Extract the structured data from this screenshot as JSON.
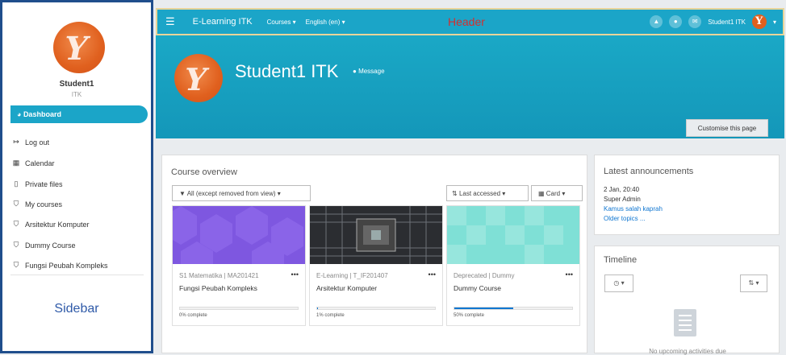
{
  "topbar": {
    "brand": "E-Learning ITK",
    "courses_menu": "Courses ▾",
    "language_menu": "English (en) ▾",
    "header_label": "Header",
    "user_name": "Student1 ITK",
    "notification_icon": "bell-icon",
    "chat_icon": "chat-icon",
    "mail_icon": "mail-icon"
  },
  "sidebar": {
    "name": "Student1",
    "sub": "ITK",
    "active_item": "Dashboard",
    "items": [
      {
        "icon": "sign-out-icon",
        "label": "Log out"
      },
      {
        "icon": "calendar-icon",
        "label": "Calendar"
      },
      {
        "icon": "file-icon",
        "label": "Private files"
      },
      {
        "icon": "graduation-cap-icon",
        "label": "My courses"
      },
      {
        "icon": "graduation-cap-icon",
        "label": "Arsitektur Komputer"
      },
      {
        "icon": "graduation-cap-icon",
        "label": "Dummy Course"
      },
      {
        "icon": "graduation-cap-icon",
        "label": "Fungsi Peubah Kompleks"
      }
    ],
    "label": "Sidebar"
  },
  "hero": {
    "name": "Student1 ITK",
    "message": "Message",
    "customise": "Customise this page"
  },
  "overview": {
    "title": "Course overview",
    "filter": "All (except removed from view) ▾",
    "sort": "Last accessed ▾",
    "view": "Card ▾",
    "courses": [
      {
        "category": "S1 Matematika | MA201421",
        "name": "Fungsi Peubah Kompleks",
        "progress": 0,
        "progress_text": "0% complete"
      },
      {
        "category": "E-Learning | T_IF201407",
        "name": "Arsitektur Komputer",
        "progress": 1,
        "progress_text": "1% complete"
      },
      {
        "category": "Deprecated | Dummy",
        "name": "Dummy Course",
        "progress": 50,
        "progress_text": "50% complete"
      }
    ]
  },
  "announcements": {
    "title": "Latest announcements",
    "date": "2 Jan, 20:40",
    "author": "Super Admin",
    "topic": "Kamus salah kaprah",
    "older": "Older topics ..."
  },
  "timeline": {
    "title": "Timeline",
    "empty": "No upcoming activities due"
  }
}
